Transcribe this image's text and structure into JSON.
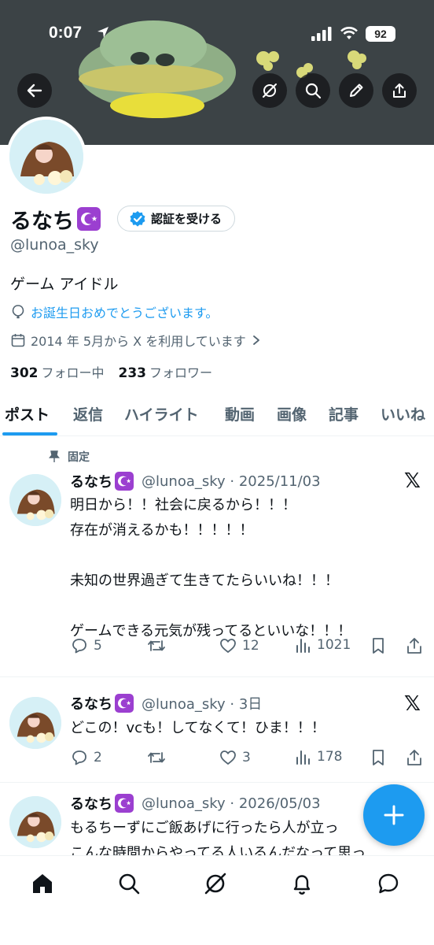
{
  "status_bar": {
    "time": "0:07",
    "battery": "92"
  },
  "profile": {
    "display_name": "るなち",
    "verify_label": "認証を受ける",
    "handle": "@lunoa_sky",
    "bio": "ゲーム アイドル",
    "birthday_text": "お誕生日おめでとうございます。",
    "joined_text": "2014 年 5月から X を利用しています",
    "following_count": "302",
    "following_label": "フォロー中",
    "followers_count": "233",
    "followers_label": "フォロワー"
  },
  "tabs": [
    {
      "label": "ポスト",
      "active": true
    },
    {
      "label": "返信"
    },
    {
      "label": "ハイライト"
    },
    {
      "label": "動画"
    },
    {
      "label": "画像"
    },
    {
      "label": "記事"
    },
    {
      "label": "いいね"
    }
  ],
  "posts": [
    {
      "pinned_label": "固定",
      "name": "るなち",
      "meta": "@lunoa_sky · 2025/11/03",
      "text": "明日から！！社会に戻るから！！！\n存在が消えるかも！！！！！\n\n未知の世界過ぎて生きてたらいいね！！！\n\nゲームできる元気が残ってるといいな！！！",
      "replies": "5",
      "reposts": "",
      "likes": "12",
      "views": "1021"
    },
    {
      "name": "るなち",
      "meta": "@lunoa_sky · 3日",
      "text": "どこの！vcも！してなくて！ひま！！！",
      "replies": "2",
      "reposts": "",
      "likes": "3",
      "views": "178"
    },
    {
      "name": "るなち",
      "meta": "@lunoa_sky · 2026/05/03",
      "text": "もるちーずにご飯あげに行ったら人が立っ\nこんな時間からやってる人いるんだなって思っ"
    }
  ],
  "colors": {
    "accent": "#1d9bf0",
    "muted": "#536471",
    "text": "#0f1419",
    "badge": "#9b3fd0"
  }
}
